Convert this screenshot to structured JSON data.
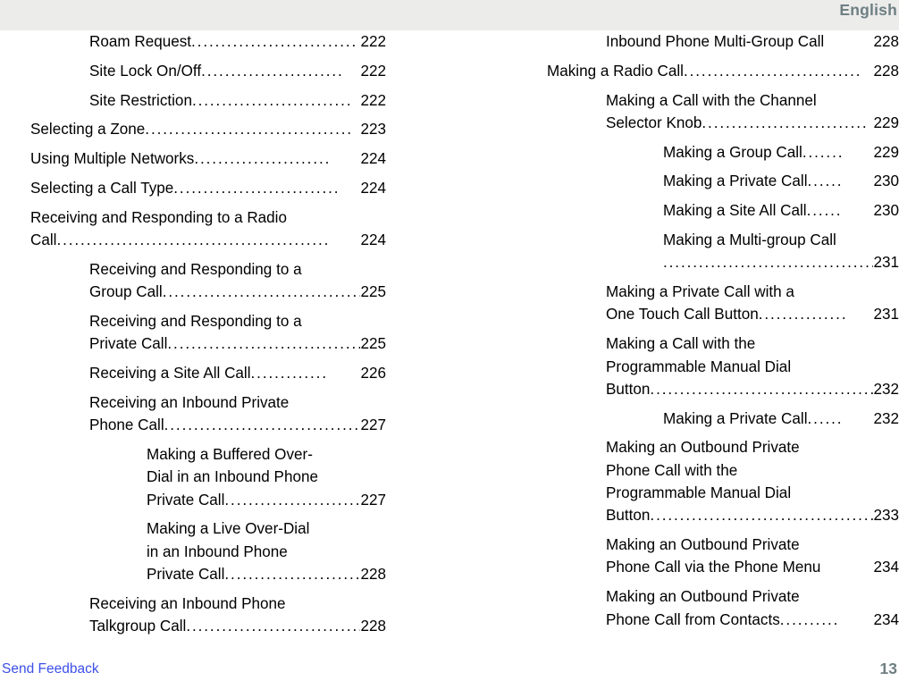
{
  "header": {
    "language_label": "English"
  },
  "footer": {
    "send_feedback_label": "Send Feedback",
    "page_number": "13"
  },
  "colors": {
    "header_band": "#ECECEA",
    "header_text": "#6E7F83",
    "body_text": "#000000",
    "link": "#3D4FE8",
    "page_number": "#6E7F83",
    "page_background": "#FFFFFF"
  },
  "toc": {
    "left_column": [
      {
        "level": 1,
        "lines": [
          "Roam Request"
        ],
        "leader": "............................",
        "page": "222"
      },
      {
        "level": 1,
        "lines": [
          "Site Lock On/Off"
        ],
        "leader": "........................",
        "page": "222"
      },
      {
        "level": 1,
        "lines": [
          "Site Restriction"
        ],
        "leader": "...........................",
        "page": "222"
      },
      {
        "level": 0,
        "lines": [
          "Selecting a Zone"
        ],
        "leader": "...................................",
        "page": "223"
      },
      {
        "level": 0,
        "lines": [
          "Using Multiple Networks"
        ],
        "leader": ".......................",
        "page": "224"
      },
      {
        "level": 0,
        "lines": [
          "Selecting a Call Type"
        ],
        "leader": "............................",
        "page": "224"
      },
      {
        "level": 0,
        "lines": [
          "Receiving and Responding to a Radio",
          "Call"
        ],
        "leader": "..............................................",
        "page": "224"
      },
      {
        "level": 1,
        "lines": [
          "Receiving and Responding to a",
          "Group Call"
        ],
        "leader": "...................................",
        "page": "225"
      },
      {
        "level": 1,
        "lines": [
          "Receiving and Responding to a",
          "Private Call"
        ],
        "leader": "..................................",
        "page": "225"
      },
      {
        "level": 1,
        "lines": [
          "Receiving a Site All Call"
        ],
        "leader": ".............",
        "page": "226"
      },
      {
        "level": 1,
        "lines": [
          "Receiving an Inbound Private",
          "Phone Call"
        ],
        "leader": "..................................",
        "page": "227"
      },
      {
        "level": 2,
        "lines": [
          "Making a Buffered Over-",
          "Dial in an Inbound Phone",
          "Private Call"
        ],
        "leader": ".......................",
        "page": "227"
      },
      {
        "level": 2,
        "lines": [
          "Making a Live Over-Dial",
          "in an Inbound Phone",
          "Private Call"
        ],
        "leader": ".......................",
        "page": "228"
      },
      {
        "level": 1,
        "lines": [
          "Receiving an Inbound Phone",
          "Talkgroup Call"
        ],
        "leader": "..............................",
        "page": "228"
      }
    ],
    "right_column": [
      {
        "level": 1,
        "lines": [
          "Inbound Phone Multi-Group Call"
        ],
        "leader": "",
        "page": "228"
      },
      {
        "level": 0,
        "lines": [
          "Making a Radio Call"
        ],
        "leader": "..............................",
        "page": "228"
      },
      {
        "level": 1,
        "lines": [
          "Making a Call with the Channel",
          "Selector Knob"
        ],
        "leader": "............................",
        "page": "229"
      },
      {
        "level": 2,
        "lines": [
          "Making a Group Call"
        ],
        "leader": ".......",
        "page": "229"
      },
      {
        "level": 2,
        "lines": [
          "Making a Private Call"
        ],
        "leader": "......",
        "page": "230"
      },
      {
        "level": 2,
        "lines": [
          "Making a Site All Call"
        ],
        "leader": "......",
        "page": "230"
      },
      {
        "level": 2,
        "lines": [
          "Making a Multi-group Call",
          ""
        ],
        "leader": ".........................................",
        "page": "231"
      },
      {
        "level": 1,
        "lines": [
          "Making a Private Call with a",
          "One Touch Call Button"
        ],
        "leader": "...............",
        "page": "231"
      },
      {
        "level": 1,
        "lines": [
          "Making a Call with the",
          "Programmable Manual Dial",
          "Button"
        ],
        "leader": "..........................................",
        "page": "232"
      },
      {
        "level": 2,
        "lines": [
          "Making a Private Call"
        ],
        "leader": "......",
        "page": "232"
      },
      {
        "level": 1,
        "lines": [
          "Making an Outbound Private",
          "Phone Call with the",
          "Programmable Manual Dial",
          "Button"
        ],
        "leader": "..........................................",
        "page": "233"
      },
      {
        "level": 1,
        "lines": [
          "Making an Outbound Private",
          "Phone Call via the Phone Menu"
        ],
        "leader": "",
        "page": "234"
      },
      {
        "level": 1,
        "lines": [
          "Making an Outbound Private",
          "Phone Call from Contacts"
        ],
        "leader": "..........",
        "page": "234"
      }
    ]
  }
}
